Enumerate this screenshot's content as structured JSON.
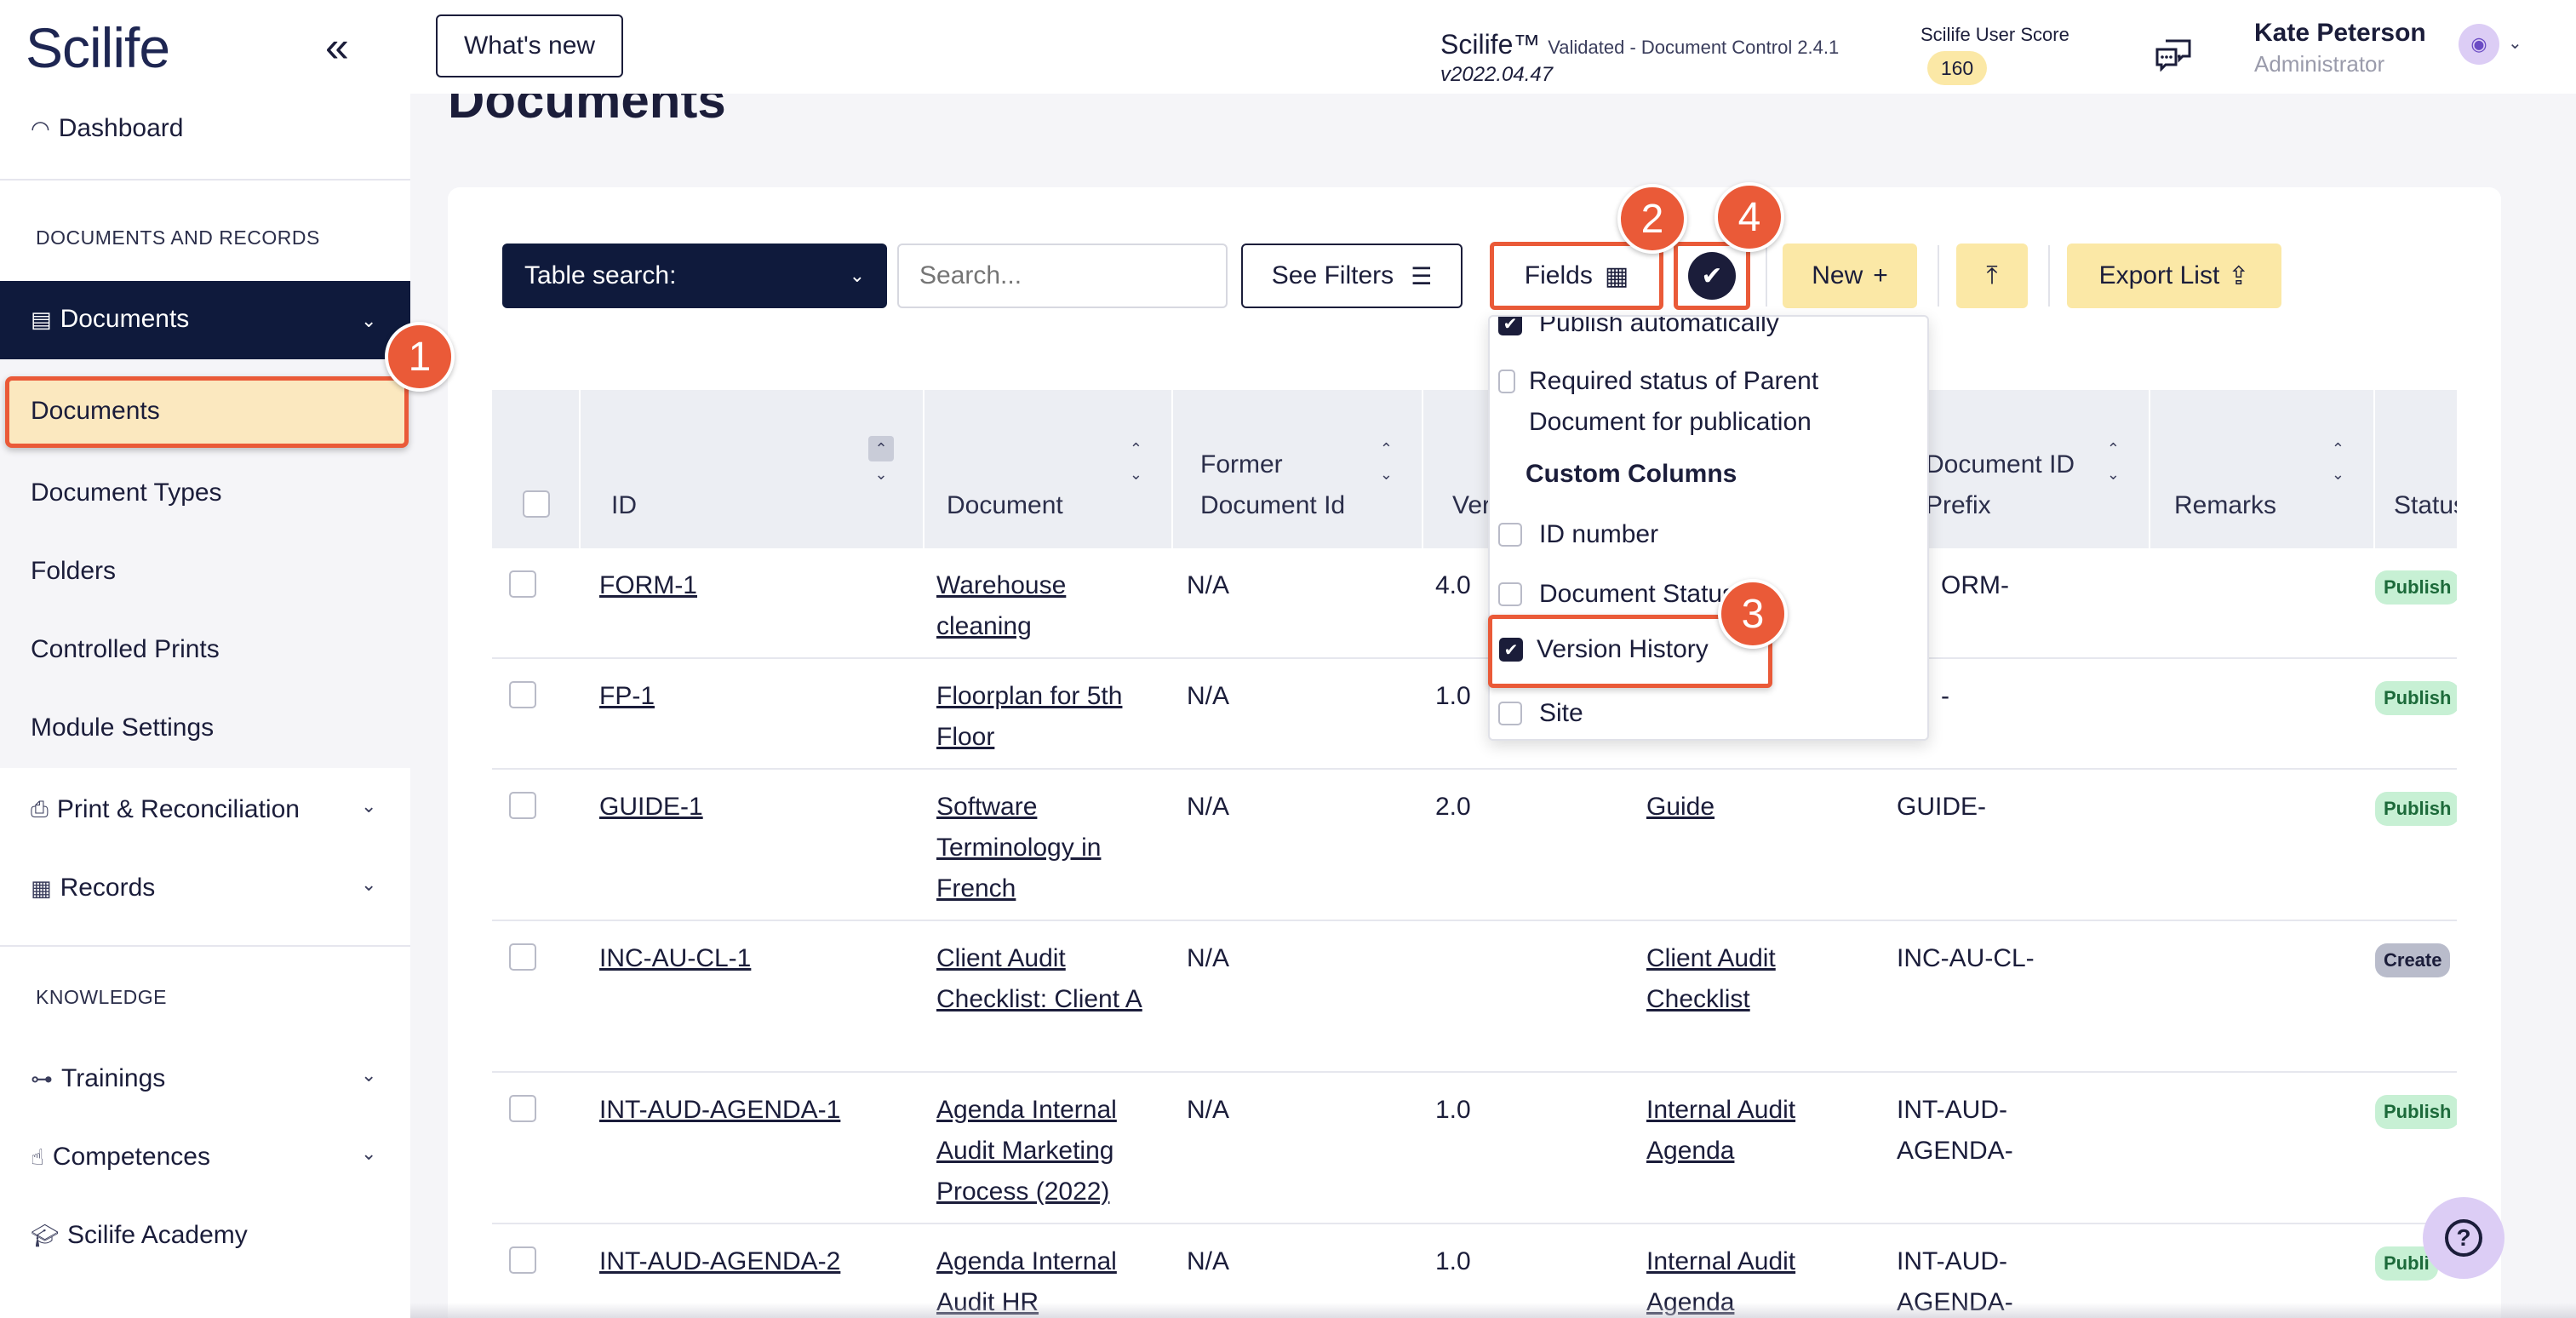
{
  "sidebar": {
    "logo": "Scilife",
    "collapse_icon": "chevrons-left-icon",
    "dashboard": "Dashboard",
    "section_documents": "DOCUMENTS AND RECORDS",
    "documents_group": "Documents",
    "sub_items": [
      "Documents",
      "Document Types",
      "Folders",
      "Controlled Prints",
      "Module Settings"
    ],
    "print_recon": "Print & Reconciliation",
    "records": "Records",
    "section_knowledge": "KNOWLEDGE",
    "trainings": "Trainings",
    "competences": "Competences",
    "academy": "Scilife Academy"
  },
  "topbar": {
    "whats_new": "What's new",
    "product": "Scilife™",
    "product_sub": "Validated - Document Control 2.4.1",
    "version": "v2022.04.47",
    "score_label": "Scilife User Score",
    "score": "160",
    "user_name": "Kate Peterson",
    "user_role": "Administrator"
  },
  "page": {
    "title": "Documents"
  },
  "toolbar": {
    "table_search": "Table search:",
    "search_placeholder": "Search...",
    "see_filters": "See Filters",
    "fields": "Fields",
    "new": "New",
    "export": "Export List"
  },
  "table": {
    "headers": [
      "ID",
      "Document",
      "Former Document Id",
      "Ver",
      "Document ID Prefix",
      "Remarks",
      "Status"
    ],
    "rows": [
      {
        "id": "FORM-1",
        "doc": "Warehouse cleaning",
        "former": "N/A",
        "ver": "4.0",
        "type": "",
        "prefix": "ORM-",
        "status": "Publish"
      },
      {
        "id": "FP-1",
        "doc": "Floorplan for 5th Floor",
        "former": "N/A",
        "ver": "1.0",
        "type": "",
        "prefix": "-",
        "status": "Publish"
      },
      {
        "id": "GUIDE-1",
        "doc": "Software Terminology in French",
        "former": "N/A",
        "ver": "2.0",
        "type": "Guide",
        "prefix": "GUIDE-",
        "status": "Publish"
      },
      {
        "id": "INC-AU-CL-1",
        "doc": "Client Audit Checklist: Client A",
        "former": "N/A",
        "ver": "",
        "type": "Client Audit Checklist",
        "prefix": "INC-AU-CL-",
        "status": "Create"
      },
      {
        "id": "INT-AUD-AGENDA-1",
        "doc": "Agenda Internal Audit Marketing Process (2022)",
        "former": "N/A",
        "ver": "1.0",
        "type": "Internal Audit Agenda",
        "prefix": "INT-AUD-AGENDA-",
        "status": "Publish"
      },
      {
        "id": "INT-AUD-AGENDA-2",
        "doc": "Agenda Internal Audit HR",
        "former": "N/A",
        "ver": "1.0",
        "type": "Internal Audit Agenda",
        "prefix": "INT-AUD-AGENDA-",
        "status": "Publi"
      }
    ]
  },
  "fields_dropdown": {
    "publish_auto": "Publish automatically",
    "required_status": "Required status of Parent Document for publication",
    "custom_header": "Custom Columns",
    "id_number": "ID number",
    "doc_status": "Document Status",
    "version_history": "Version History",
    "site": "Site"
  },
  "steps": [
    "1",
    "2",
    "3",
    "4"
  ],
  "colors": {
    "navy": "#0f1a3c",
    "accent": "#ea5a38",
    "yellow": "#fbe8a6",
    "green_badge": "#c7f0d4"
  }
}
